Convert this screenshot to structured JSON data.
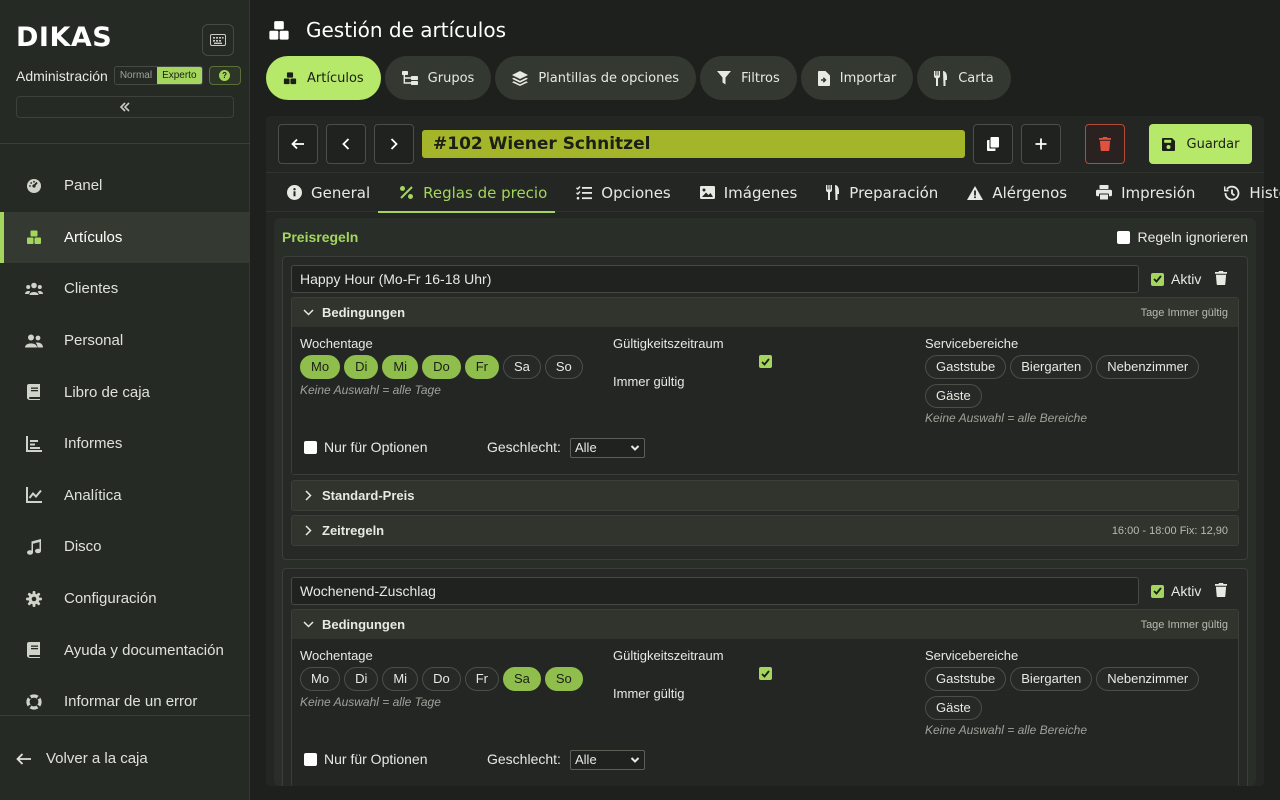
{
  "sidebar": {
    "logo": "DIKAS",
    "admin_label": "Administración",
    "modes": [
      "Normal",
      "Experto"
    ],
    "active_mode": "Experto",
    "items": [
      {
        "label": "Panel",
        "icon": "gauge-icon"
      },
      {
        "label": "Artículos",
        "icon": "boxes-icon",
        "active": true
      },
      {
        "label": "Clientes",
        "icon": "users-icon"
      },
      {
        "label": "Personal",
        "icon": "staff-icon"
      },
      {
        "label": "Libro de caja",
        "icon": "book-icon"
      },
      {
        "label": "Informes",
        "icon": "bar-chart-icon"
      },
      {
        "label": "Analítica",
        "icon": "line-chart-icon"
      },
      {
        "label": "Disco",
        "icon": "music-icon"
      },
      {
        "label": "Configuración",
        "icon": "gear-icon"
      },
      {
        "label": "Ayuda y documentación",
        "icon": "help-book-icon"
      },
      {
        "label": "Informar de un error",
        "icon": "lifebuoy-icon"
      }
    ],
    "back_label": "Volver a la caja"
  },
  "header": {
    "title": "Gestión de artículos",
    "tabs": [
      {
        "label": "Artículos",
        "active": true
      },
      {
        "label": "Grupos"
      },
      {
        "label": "Plantillas de opciones"
      },
      {
        "label": "Filtros"
      },
      {
        "label": "Importar"
      },
      {
        "label": "Carta"
      }
    ]
  },
  "toolbar": {
    "article_title": "#102 Wiener Schnitzel",
    "save_label": "Guardar"
  },
  "subtabs": [
    {
      "label": "General"
    },
    {
      "label": "Reglas de precio",
      "active": true
    },
    {
      "label": "Opciones"
    },
    {
      "label": "Imágenes"
    },
    {
      "label": "Preparación"
    },
    {
      "label": "Alérgenos"
    },
    {
      "label": "Impresión"
    },
    {
      "label": "Historial"
    }
  ],
  "price_rules": {
    "title": "Preisregeln",
    "ignore_label": "Regeln ignorieren",
    "ignore_checked": false,
    "rules": [
      {
        "name": "Happy Hour (Mo-Fr 16-18 Uhr)",
        "active_label": "Aktiv",
        "active": true,
        "conditions_label": "Bedingungen",
        "conditions_summary": "Tage Immer gültig",
        "weekdays_label": "Wochentage",
        "days": [
          {
            "label": "Mo",
            "on": true
          },
          {
            "label": "Di",
            "on": true
          },
          {
            "label": "Mi",
            "on": true
          },
          {
            "label": "Do",
            "on": true
          },
          {
            "label": "Fr",
            "on": true
          },
          {
            "label": "Sa",
            "on": false
          },
          {
            "label": "So",
            "on": false
          }
        ],
        "days_hint": "Keine Auswahl = alle Tage",
        "validity_label": "Gültigkeitszeitraum",
        "always_valid_label": "Immer gültig",
        "always_valid": true,
        "service_label": "Servicebereiche",
        "areas": [
          "Gaststube",
          "Biergarten",
          "Nebenzimmer",
          "Gäste"
        ],
        "areas_hint": "Keine Auswahl = alle Bereiche",
        "options_only_label": "Nur für Optionen",
        "gender_label": "Geschlecht:",
        "gender_value": "Alle",
        "std_price_label": "Standard-Preis",
        "time_rules_label": "Zeitregeln",
        "time_rules_summary": "16:00 - 18:00 Fix: 12,90"
      },
      {
        "name": "Wochenend-Zuschlag",
        "active_label": "Aktiv",
        "active": true,
        "conditions_label": "Bedingungen",
        "conditions_summary": "Tage Immer gültig",
        "weekdays_label": "Wochentage",
        "days": [
          {
            "label": "Mo",
            "on": false
          },
          {
            "label": "Di",
            "on": false
          },
          {
            "label": "Mi",
            "on": false
          },
          {
            "label": "Do",
            "on": false
          },
          {
            "label": "Fr",
            "on": false
          },
          {
            "label": "Sa",
            "on": true
          },
          {
            "label": "So",
            "on": true
          }
        ],
        "days_hint": "Keine Auswahl = alle Tage",
        "validity_label": "Gültigkeitszeitraum",
        "always_valid_label": "Immer gültig",
        "always_valid": true,
        "service_label": "Servicebereiche",
        "areas": [
          "Gaststube",
          "Biergarten",
          "Nebenzimmer",
          "Gäste"
        ],
        "areas_hint": "Keine Auswahl = alle Bereiche",
        "options_only_label": "Nur für Optionen",
        "gender_label": "Geschlecht:",
        "gender_value": "Alle"
      }
    ]
  },
  "colors": {
    "accent": "#a4d65e",
    "accent_bright": "#b6e86a",
    "title_field": "#a4b52a",
    "danger": "#e0523f"
  }
}
